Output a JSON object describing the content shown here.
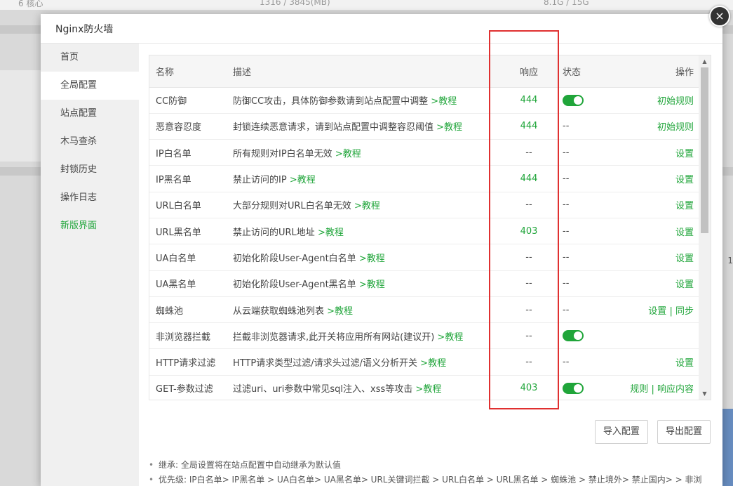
{
  "background": {
    "top_left": "6 核心",
    "top_mid": "1316 / 3845(MB)",
    "top_right": "8.1G / 15G",
    "right_edge": "1"
  },
  "dialog": {
    "title": "Nginx防火墙",
    "close_label": "×"
  },
  "sidebar": {
    "items": [
      {
        "label": "首页"
      },
      {
        "label": "全局配置"
      },
      {
        "label": "站点配置"
      },
      {
        "label": "木马查杀"
      },
      {
        "label": "封锁历史"
      },
      {
        "label": "操作日志"
      },
      {
        "label": "新版界面"
      }
    ]
  },
  "table": {
    "headers": {
      "name": "名称",
      "desc": "描述",
      "resp": "响应",
      "status": "状态",
      "ops": "操作"
    },
    "tutorial_label": ">教程",
    "rows": [
      {
        "name": "CC防御",
        "desc": "防御CC攻击，具体防御参数请到站点配置中调整",
        "resp": "444",
        "status": "on",
        "op1": "初始规则",
        "op2": ""
      },
      {
        "name": "恶意容忍度",
        "desc": "封锁连续恶意请求，请到站点配置中调整容忍阈值",
        "resp": "444",
        "status": "--",
        "op1": "初始规则",
        "op2": ""
      },
      {
        "name": "IP白名单",
        "desc": "所有规则对IP白名单无效",
        "resp": "--",
        "status": "--",
        "op1": "设置",
        "op2": ""
      },
      {
        "name": "IP黑名单",
        "desc": "禁止访问的IP",
        "resp": "444",
        "status": "--",
        "op1": "设置",
        "op2": ""
      },
      {
        "name": "URL白名单",
        "desc": "大部分规则对URL白名单无效",
        "resp": "--",
        "status": "--",
        "op1": "设置",
        "op2": ""
      },
      {
        "name": "URL黑名单",
        "desc": "禁止访问的URL地址",
        "resp": "403",
        "status": "--",
        "op1": "设置",
        "op2": ""
      },
      {
        "name": "UA白名单",
        "desc": "初始化阶段User-Agent白名单",
        "resp": "--",
        "status": "--",
        "op1": "设置",
        "op2": ""
      },
      {
        "name": "UA黑名单",
        "desc": "初始化阶段User-Agent黑名单",
        "resp": "--",
        "status": "--",
        "op1": "设置",
        "op2": ""
      },
      {
        "name": "蜘蛛池",
        "desc": "从云端获取蜘蛛池列表",
        "resp": "--",
        "status": "--",
        "op1": "设置",
        "op2": "同步"
      },
      {
        "name": "非浏览器拦截",
        "desc": "拦截非浏览器请求,此开关将应用所有网站(建议开)",
        "resp": "--",
        "status": "on",
        "op1": "",
        "op2": ""
      },
      {
        "name": "HTTP请求过滤",
        "desc": "HTTP请求类型过滤/请求头过滤/语义分析开关",
        "resp": "--",
        "status": "--",
        "op1": "设置",
        "op2": ""
      },
      {
        "name": "GET-参数过滤",
        "desc": "过滤uri、uri参数中常见sql注入、xss等攻击",
        "resp": "403",
        "status": "on",
        "op1": "规则",
        "op2": "响应内容"
      }
    ]
  },
  "buttons": {
    "import": "导入配置",
    "export": "导出配置"
  },
  "notes": [
    "继承: 全局设置将在站点配置中自动继承为默认值",
    "优先级: IP白名单> IP黑名单 > UA白名单> UA黑名单> URL关键词拦截 > URL白名单 > URL黑名单 > 蜘蛛池 > 禁止境外> 禁止国内> > 非浏览器拦截> User-Agent > CC防御 > Cookie > URI过滤 > URL参数 > Thinkphp防御> POST > 网站自定义防御"
  ],
  "colors": {
    "accent": "#20a53a",
    "highlight": "#e03030"
  }
}
